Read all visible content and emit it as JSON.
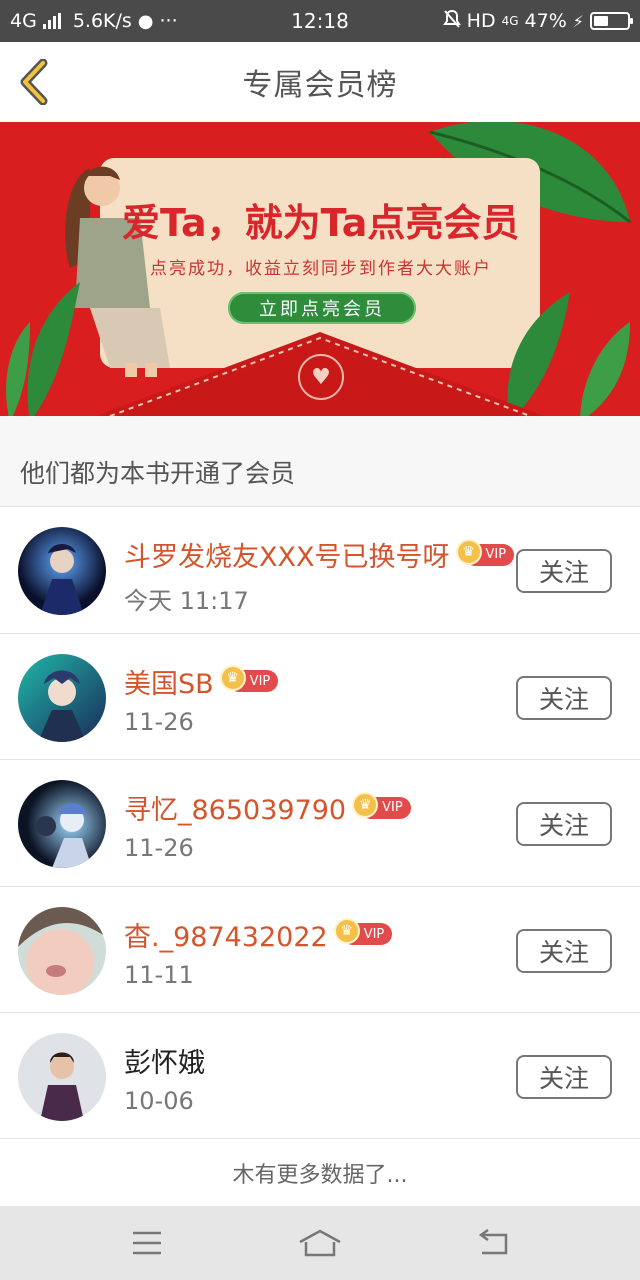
{
  "status_bar": {
    "network": "4G",
    "speed": "5.6K/s",
    "time": "12:18",
    "hd": "HD",
    "net2": "4G",
    "battery": "47%"
  },
  "header": {
    "title": "专属会员榜",
    "back_icon": "chevron-left-icon"
  },
  "banner": {
    "headline": "爱Ta，就为Ta点亮会员",
    "subline": "点亮成功，收益立刻同步到作者大大账户",
    "cta": "立即点亮会员"
  },
  "section": {
    "title": "他们都为本书开通了会员"
  },
  "members": [
    {
      "name": "斗罗发烧友XXX号已换号呀",
      "date": "今天 11:17",
      "vip": true,
      "vip_label": "VIP",
      "follow": "关注"
    },
    {
      "name": "美国SB",
      "date": "11-26",
      "vip": true,
      "vip_label": "VIP",
      "follow": "关注"
    },
    {
      "name": "寻忆_865039790",
      "date": "11-26",
      "vip": true,
      "vip_label": "VIP",
      "follow": "关注"
    },
    {
      "name": "杳._987432022",
      "date": "11-11",
      "vip": true,
      "vip_label": "VIP",
      "follow": "关注"
    },
    {
      "name": "彭怀娥",
      "date": "10-06",
      "vip": false,
      "follow": "关注"
    }
  ],
  "footer": {
    "message": "木有更多数据了..."
  },
  "nav": {
    "menu_icon": "menu-icon",
    "home_icon": "home-icon",
    "back_icon": "back-arrow-icon"
  },
  "colors": {
    "banner_red": "#d81e1e",
    "vip_name": "#d4552c",
    "cta_green": "#2e8c3b"
  }
}
